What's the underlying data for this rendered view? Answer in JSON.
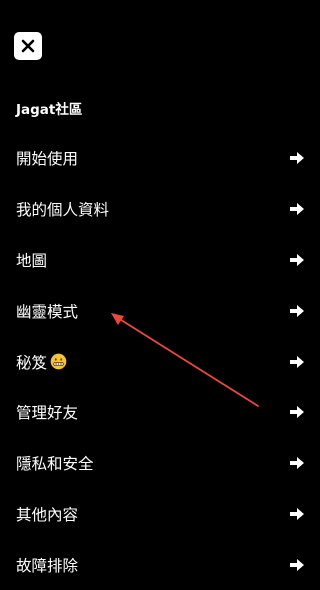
{
  "header": {
    "close_icon": "close-icon"
  },
  "section": {
    "title": "Jagat社區"
  },
  "menu": {
    "items": [
      {
        "label": "開始使用"
      },
      {
        "label": "我的個人資料"
      },
      {
        "label": "地圖"
      },
      {
        "label": "幽靈模式"
      },
      {
        "label": "秘笈",
        "emoji": "zipper-mouth-face"
      },
      {
        "label": "管理好友"
      },
      {
        "label": "隱私和安全"
      },
      {
        "label": "其他內容"
      },
      {
        "label": "故障排除"
      }
    ],
    "item_icon": "arrow-right-icon"
  },
  "annotation": {
    "color": "#e8493a",
    "points_to": "幽靈模式"
  },
  "colors": {
    "background": "#000000",
    "text": "#ffffff",
    "close_button_bg": "#ffffff",
    "close_icon": "#000000",
    "annotation_arrow": "#e8493a",
    "emoji": "#f7c233"
  }
}
